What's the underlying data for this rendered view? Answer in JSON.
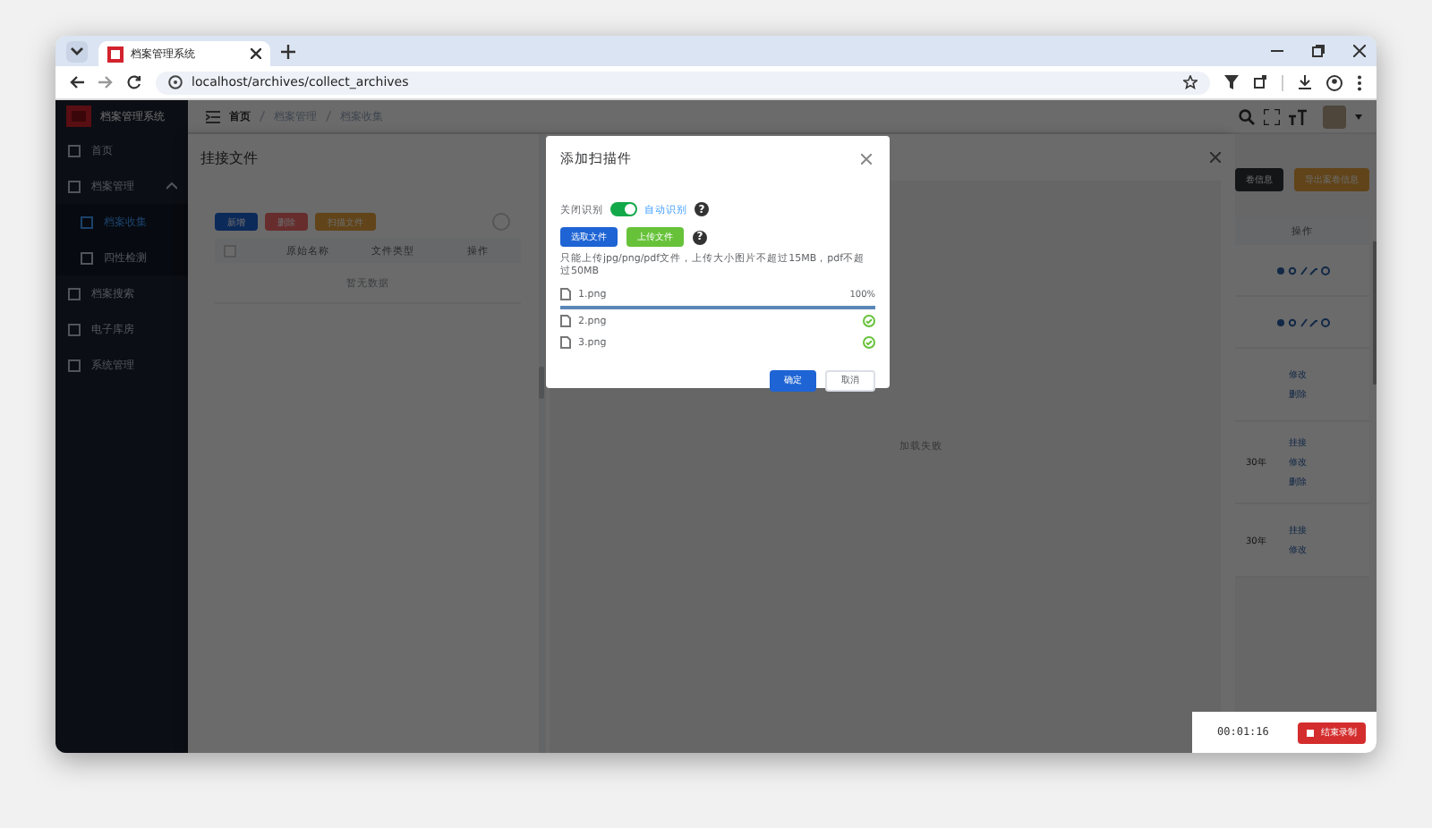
{
  "browser": {
    "tab_title": "档案管理系统",
    "url": "localhost/archives/collect_archives"
  },
  "app": {
    "logo_text": "档案管理系统",
    "sidebar": [
      {
        "label": "首页",
        "selected": false
      },
      {
        "label": "档案管理",
        "selected": false,
        "expanded": true,
        "children": [
          {
            "label": "档案收集",
            "selected": true
          },
          {
            "label": "四性检测",
            "selected": false
          }
        ]
      },
      {
        "label": "档案搜索",
        "selected": false
      },
      {
        "label": "电子库房",
        "selected": false
      },
      {
        "label": "系统管理",
        "selected": false
      }
    ],
    "breadcrumb": [
      {
        "label": "首页",
        "selected": true
      },
      {
        "label": "档案管理",
        "selected": false
      },
      {
        "label": "档案收集",
        "selected": false
      }
    ]
  },
  "drawer": {
    "title": "挂接文件",
    "toolbar": [
      {
        "label": "新增",
        "kind": "primary"
      },
      {
        "label": "删除",
        "kind": "danger"
      },
      {
        "label": "扫描文件",
        "kind": "warning"
      }
    ],
    "select_all_checked": false,
    "columns": [
      "原始名称",
      "文件类型",
      "操作"
    ],
    "empty_text": "暂无数据",
    "preview_text": "加载失败"
  },
  "background_table": {
    "buttons": [
      {
        "label": "卷信息",
        "kind": "dark"
      },
      {
        "label": "导出案卷信息",
        "kind": "warning"
      }
    ],
    "column": "操作",
    "rows": [
      {
        "kind": "icons",
        "period": "",
        "links": []
      },
      {
        "kind": "icons",
        "period": "",
        "links": []
      },
      {
        "kind": "links",
        "period": "",
        "links": [
          "修改",
          "删除"
        ]
      },
      {
        "kind": "links",
        "period": "30年",
        "links": [
          "挂接",
          "修改",
          "删除"
        ]
      },
      {
        "kind": "links",
        "period": "30年",
        "links": [
          "挂接",
          "修改"
        ]
      }
    ]
  },
  "modal": {
    "title": "添加扫描件",
    "switch": {
      "off_label": "关闭识别",
      "on_label": "自动识别",
      "on": true,
      "help": "?"
    },
    "buttons": [
      {
        "label": "选取文件",
        "kind": "primary"
      },
      {
        "label": "上传文件",
        "kind": "success"
      }
    ],
    "buttons_help": "?",
    "hint": "只能上传jpg/png/pdf文件，上传大小图片不超过15MB，pdf不超过50MB",
    "files": [
      {
        "name": "1.png",
        "kind": "uploading",
        "level": 1,
        "reading": "100%"
      },
      {
        "name": "2.png",
        "kind": "done"
      },
      {
        "name": "3.png",
        "kind": "done"
      }
    ],
    "footer": [
      {
        "label": "确定",
        "kind": "primary"
      },
      {
        "label": "取消",
        "kind": "plain"
      }
    ]
  },
  "recorder": {
    "time": "00:01:16",
    "button": "结束录制"
  }
}
